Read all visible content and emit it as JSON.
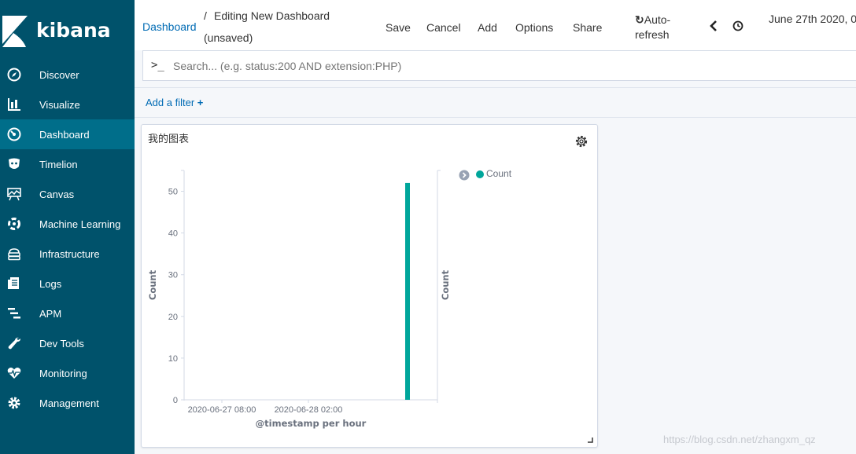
{
  "app": {
    "logo_text": "kibana"
  },
  "sidebar": {
    "items": [
      {
        "label": "Discover",
        "icon": "compass-icon"
      },
      {
        "label": "Visualize",
        "icon": "bar-chart-icon"
      },
      {
        "label": "Dashboard",
        "icon": "dashboard-icon",
        "active": true
      },
      {
        "label": "Timelion",
        "icon": "timelion-icon"
      },
      {
        "label": "Canvas",
        "icon": "canvas-icon"
      },
      {
        "label": "Machine Learning",
        "icon": "machine-learning-icon"
      },
      {
        "label": "Infrastructure",
        "icon": "infrastructure-icon"
      },
      {
        "label": "Logs",
        "icon": "logs-icon"
      },
      {
        "label": "APM",
        "icon": "apm-icon"
      },
      {
        "label": "Dev Tools",
        "icon": "wrench-icon"
      },
      {
        "label": "Monitoring",
        "icon": "heartbeat-icon"
      },
      {
        "label": "Management",
        "icon": "gear-icon"
      }
    ]
  },
  "header": {
    "breadcrumb_link": "Dashboard",
    "breadcrumb_sep": "/",
    "title_line1": "Editing New Dashboard",
    "title_line2": "(unsaved)",
    "menu": {
      "save": "Save",
      "cancel": "Cancel",
      "add": "Add",
      "options": "Options",
      "share": "Share"
    },
    "refresh_line1": "Auto-",
    "refresh_line2": "refresh",
    "refresh_icon": "↻",
    "date": "June 27th 2020, 0"
  },
  "search": {
    "prompt": ">_",
    "placeholder": "Search... (e.g. status:200 AND extension:PHP)"
  },
  "filter": {
    "add_label": "Add a filter",
    "plus": "+"
  },
  "panel": {
    "title": "我的图表",
    "legend_label": "Count"
  },
  "chart_data": {
    "type": "bar",
    "xlabel": "@timestamp per hour",
    "ylabel": "Count",
    "ylabel_right": "Count",
    "x_ticks": [
      "2020-06-27 08:00",
      "2020-06-28 02:00"
    ],
    "y_ticks": [
      0,
      10,
      20,
      30,
      40,
      50
    ],
    "ylim": [
      0,
      55
    ],
    "series": [
      {
        "name": "Count",
        "color": "#00a69b",
        "values": [
          52
        ]
      }
    ],
    "legend": "top-right"
  },
  "watermark": "https://blog.csdn.net/zhangxm_qz"
}
